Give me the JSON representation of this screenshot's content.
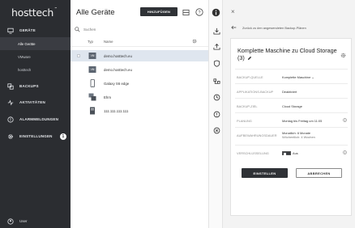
{
  "sidebar": {
    "logo": "hosttech",
    "devices_label": "GERÄTE",
    "sub_items": [
      "Alle Geräte",
      "VMware",
      "hosttech"
    ],
    "backups_label": "BACKUPS",
    "activities_label": "AKTIVITÄTEN",
    "alarm_label": "ALARMMELDUNGEN",
    "settings_label": "EINSTELLUNGEN",
    "settings_badge": "1",
    "user_label": "User"
  },
  "list": {
    "title": "Alle Geräte",
    "add_label": "HINZUFÜGEN",
    "search_placeholder": "Suchen",
    "col_type": "Typ",
    "col_name": "Name",
    "rows": [
      {
        "name": "demo.hosttech.eu",
        "icon": "server-icon"
      },
      {
        "name": "demo.hosttech.eu",
        "icon": "server-icon"
      },
      {
        "name": "Galaxy S6 edge",
        "icon": "phone-icon"
      },
      {
        "name": "Ehm",
        "icon": "vm-icon"
      },
      {
        "name": "111.111.111.111",
        "icon": "desktop-icon"
      }
    ]
  },
  "panel": {
    "close": "×",
    "back_label": "Zurück zu den angewendeten Backup-Plänen",
    "card_title": "Komplette Maschine zu Cloud Storage (3)",
    "fields": [
      {
        "key": "BACKUP-QUELLE",
        "value": "Komplette Maschine ⌄"
      },
      {
        "key": "APPLIKATIONS-BACKUP",
        "value": "Deaktiviert"
      },
      {
        "key": "BACKUP-ZIEL",
        "value": "Cloud Storage"
      },
      {
        "key": "PLANUNG",
        "value": "Montag bis Freitag um 11:05"
      },
      {
        "key": "AUFBEWAHRUNGSDAUER",
        "value": "Monatlich: 6 Monate",
        "value2": "Wöchentlich: 4 Wochen"
      },
      {
        "key": "VERSCHLÜSSELUNG",
        "value": "Aus"
      }
    ],
    "confirm_label": "EINSTELLEN",
    "cancel_label": "ABBRECHEN"
  },
  "colors": {
    "sidebar_bg": "#2b2d31",
    "selected_row": "#dfe6ef",
    "link_blue": "#2a6db5",
    "button_dark": "#2f3236"
  }
}
